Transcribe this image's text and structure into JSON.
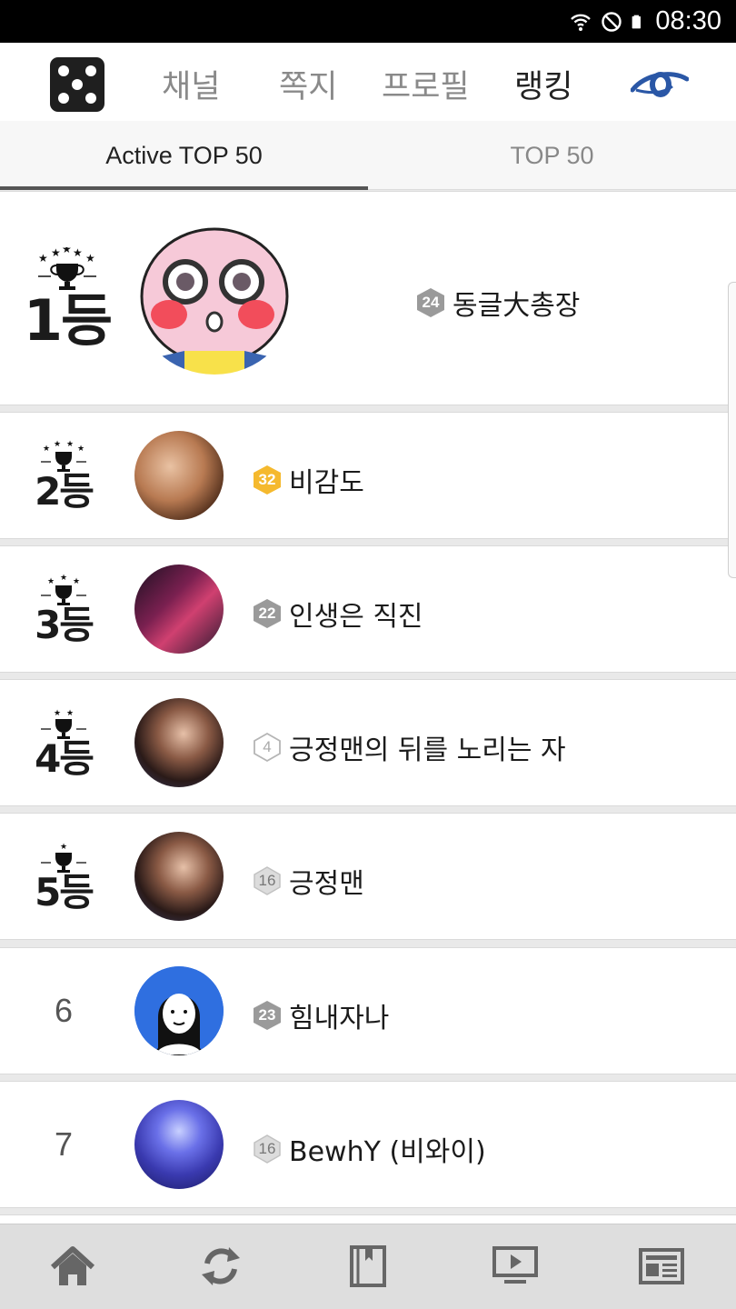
{
  "status": {
    "time": "08:30"
  },
  "nav": {
    "items": [
      {
        "label": "채널"
      },
      {
        "label": "쪽지"
      },
      {
        "label": "프로필"
      },
      {
        "label": "랭킹"
      }
    ]
  },
  "tabs": [
    {
      "label": "Active TOP 50"
    },
    {
      "label": "TOP 50"
    }
  ],
  "ranking": [
    {
      "rank": "1등",
      "stars": 5,
      "level": "24",
      "level_style": "gray",
      "name": "동글大총장",
      "avatar": "pink-character"
    },
    {
      "rank": "2등",
      "stars": 4,
      "level": "32",
      "level_style": "gold",
      "name": "비감도",
      "avatar": "portrait-brown"
    },
    {
      "rank": "3등",
      "stars": 3,
      "level": "22",
      "level_style": "gray",
      "name": "인생은 직진",
      "avatar": "anime-fighter"
    },
    {
      "rank": "4등",
      "stars": 2,
      "level": "4",
      "level_style": "outline",
      "name": "긍정맨의 뒤를 노리는 자",
      "avatar": "portrait-dark"
    },
    {
      "rank": "5등",
      "stars": 1,
      "level": "16",
      "level_style": "light",
      "name": "긍정맨",
      "avatar": "portrait-dark"
    },
    {
      "rank": "6",
      "stars": 0,
      "level": "23",
      "level_style": "gray",
      "name": "힘내자나",
      "avatar": "blue-default"
    },
    {
      "rank": "7",
      "stars": 0,
      "level": "16",
      "level_style": "light",
      "name": "BewhY (비와이)",
      "avatar": "stage-blue"
    }
  ],
  "bottom_nav": [
    "home-icon",
    "refresh-icon",
    "bookmark-book-icon",
    "play-screen-icon",
    "news-icon"
  ],
  "colors": {
    "gold_badge": "#f5b92e",
    "gray_badge": "#9a9a9a",
    "brand_eye": "#2a57a6"
  }
}
